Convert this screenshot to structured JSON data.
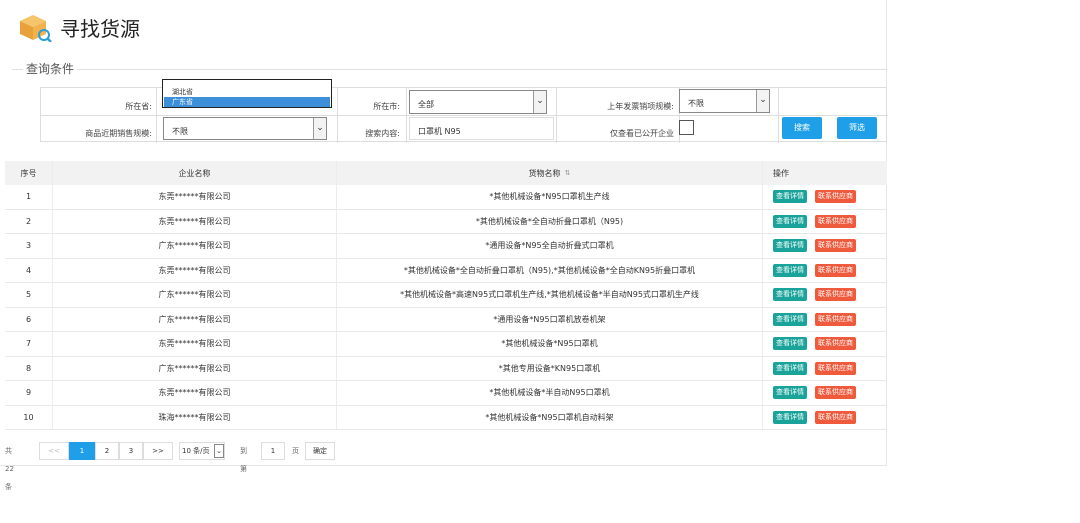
{
  "header": {
    "title": "寻找货源"
  },
  "section": {
    "label": "查询条件"
  },
  "filters": {
    "province_label": "所在省:",
    "province_options": [
      "湖北省",
      "广东省"
    ],
    "province_selected": "广东省",
    "city_label": "所在市:",
    "city_value": "全部",
    "last_year_label": "上年发票销项规模:",
    "last_year_value": "不限",
    "recent_sales_label": "商品近期销售规模:",
    "recent_sales_value": "不限",
    "search_label": "搜索内容:",
    "search_value": "口罩机 N95",
    "public_only_label": "仅查看已公开企业",
    "search_button": "搜索",
    "filter_button": "筛选"
  },
  "table": {
    "columns": [
      "序号",
      "企业名称",
      "货物名称",
      "操作"
    ],
    "actions": {
      "view": "查看详情",
      "contact": "联系供应商"
    },
    "rows": [
      {
        "no": "1",
        "company": "东莞******有限公司",
        "goods": "*其他机械设备*N95口罩机生产线"
      },
      {
        "no": "2",
        "company": "东莞******有限公司",
        "goods": "*其他机械设备*全自动折叠口罩机（N95)"
      },
      {
        "no": "3",
        "company": "广东******有限公司",
        "goods": "*通用设备*N95全自动折叠式口罩机"
      },
      {
        "no": "4",
        "company": "东莞******有限公司",
        "goods": "*其他机械设备*全自动折叠口罩机（N95),*其他机械设备*全自动KN95折叠口罩机"
      },
      {
        "no": "5",
        "company": "广东******有限公司",
        "goods": "*其他机械设备*高速N95式口罩机生产线,*其他机械设备*半自动N95式口罩机生产线"
      },
      {
        "no": "6",
        "company": "广东******有限公司",
        "goods": "*通用设备*N95口罩机放卷机架"
      },
      {
        "no": "7",
        "company": "东莞******有限公司",
        "goods": "*其他机械设备*N95口罩机"
      },
      {
        "no": "8",
        "company": "广东******有限公司",
        "goods": "*其他专用设备*KN95口罩机"
      },
      {
        "no": "9",
        "company": "东莞******有限公司",
        "goods": "*其他机械设备*半自动N95口罩机"
      },
      {
        "no": "10",
        "company": "珠海******有限公司",
        "goods": "*其他机械设备*N95口罩机自动料架"
      }
    ]
  },
  "pagination": {
    "total": "共 22 条",
    "prev": "<<",
    "pages": [
      "1",
      "2",
      "3"
    ],
    "current": "1",
    "next": ">>",
    "page_size": "10 条/页",
    "goto_label": "到第",
    "goto_value": "1",
    "page_unit": "页",
    "confirm": "确定"
  },
  "colors": {
    "primary": "#1e9fe8",
    "view": "#1aa39a",
    "contact": "#f05a3c",
    "dropdown_selected": "#3c8fd8"
  }
}
